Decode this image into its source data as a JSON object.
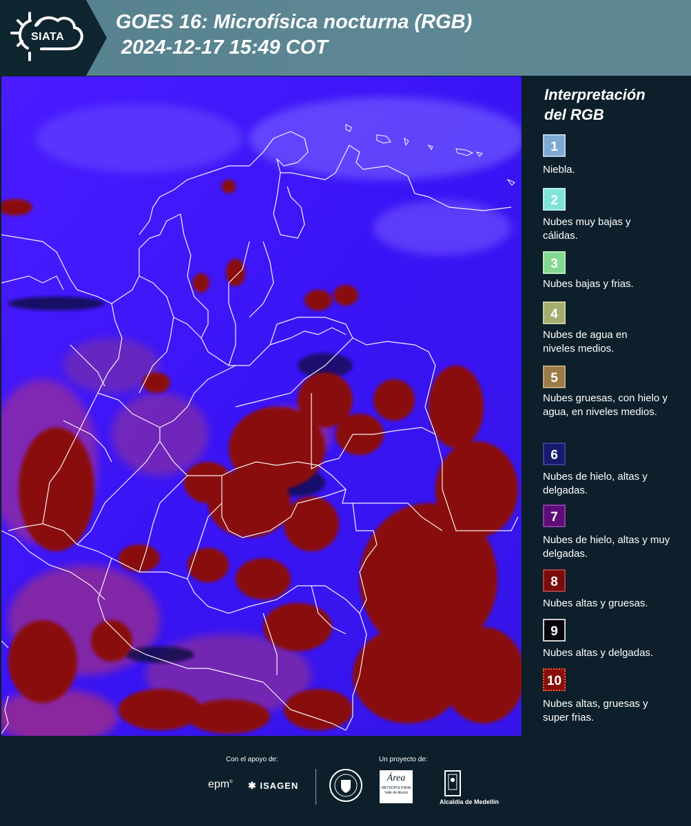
{
  "header": {
    "logo_text": "SIATA",
    "title_line1": "GOES 16: Microfísica nocturna (RGB)",
    "title_line2": " 2024-12-17 15:49 COT"
  },
  "legend": {
    "title_line1": "Interpretación",
    "title_line2": "del RGB",
    "items": [
      {
        "num": "1",
        "color": "#7fa9d1",
        "text_color": "#ffffff",
        "label": "Niebla."
      },
      {
        "num": "2",
        "color": "#7fe3da",
        "text_color": "#ffffff",
        "label": "Nubes muy bajas y cálidas."
      },
      {
        "num": "3",
        "color": "#82d98f",
        "text_color": "#ffffff",
        "label": "Nubes bajas y frias."
      },
      {
        "num": "4",
        "color": "#a3ad6d",
        "text_color": "#ffffff",
        "label": "Nubes de agua en niveles medios."
      },
      {
        "num": "5",
        "color": "#9a7b48",
        "text_color": "#ffffff",
        "label": "Nubes gruesas, con hielo y agua, en niveles medios."
      },
      {
        "num": "6",
        "color": "#161b6e",
        "text_color": "#ffffff",
        "label": "Nubes de hielo, altas y delgadas."
      },
      {
        "num": "7",
        "color": "#5d0c78",
        "text_color": "#ffffff",
        "label": "Nubes de hielo, altas y muy delgadas."
      },
      {
        "num": "8",
        "color": "#7a0b0b",
        "text_color": "#ffffff",
        "label": "Nubes altas y gruesas."
      },
      {
        "num": "9",
        "color": "#05050a",
        "text_color": "#ffffff",
        "label": "Nubes altas y delgadas."
      },
      {
        "num": "10",
        "color": "#8a0e08",
        "text_color": "#ffffff",
        "label": "Nubes altas, gruesas y super frias."
      }
    ]
  },
  "footer": {
    "support_label": "Con el apoyo de:",
    "project_label": "Un proyecto de:",
    "epm": "epm",
    "isagen": "ISAGEN",
    "area_name": "Área",
    "area_sub": "METROPOLITANA",
    "area_sub2": "Valle de Aburrá",
    "alcaldia": "Alcaldía de Medellín"
  }
}
